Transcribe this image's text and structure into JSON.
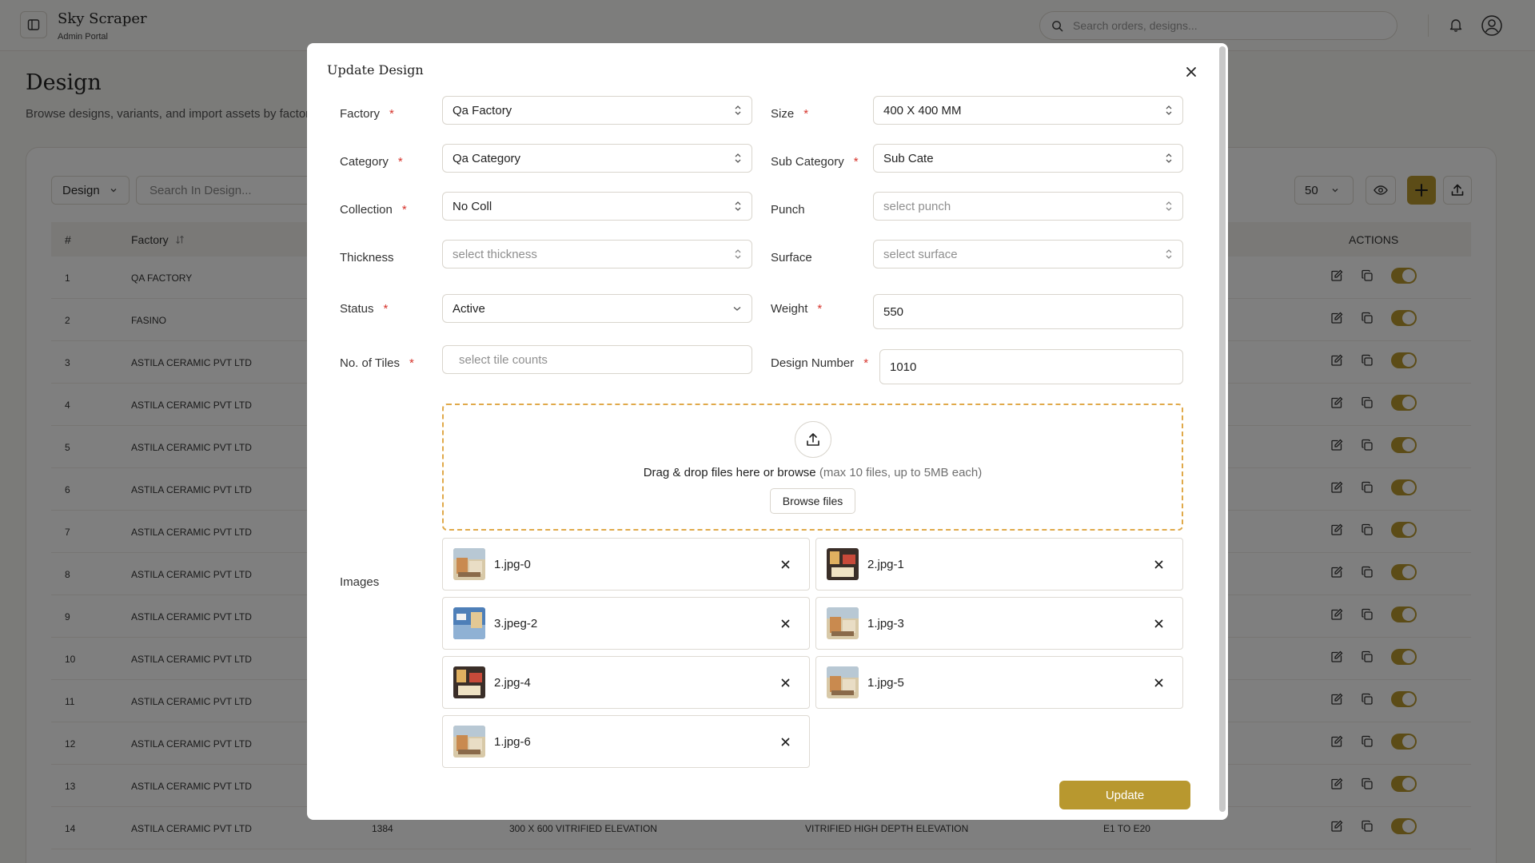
{
  "app": {
    "name": "Sky Scraper",
    "subtitle": "Admin Portal"
  },
  "topbar": {
    "search_placeholder": "Search orders, designs..."
  },
  "page": {
    "title": "Design",
    "subtitle": "Browse designs, variants, and import assets by factory"
  },
  "toolbar": {
    "design_select": "Design",
    "search_placeholder": "Search In Design...",
    "per_page": "50"
  },
  "table": {
    "columns": {
      "index": "#",
      "factory": "Factory",
      "actions": "ACTIONS"
    },
    "rows": [
      {
        "n": "1",
        "factory": "QA FACTORY",
        "c3": "",
        "c4": "",
        "c5": "",
        "c6": ""
      },
      {
        "n": "2",
        "factory": "FASINO",
        "c3": "",
        "c4": "",
        "c5": "",
        "c6": ""
      },
      {
        "n": "3",
        "factory": "ASTILA CERAMIC PVT LTD",
        "c3": "",
        "c4": "",
        "c5": "",
        "c6": ""
      },
      {
        "n": "4",
        "factory": "ASTILA CERAMIC PVT LTD",
        "c3": "",
        "c4": "",
        "c5": "",
        "c6": ""
      },
      {
        "n": "5",
        "factory": "ASTILA CERAMIC PVT LTD",
        "c3": "",
        "c4": "",
        "c5": "",
        "c6": ""
      },
      {
        "n": "6",
        "factory": "ASTILA CERAMIC PVT LTD",
        "c3": "",
        "c4": "",
        "c5": "",
        "c6": ""
      },
      {
        "n": "7",
        "factory": "ASTILA CERAMIC PVT LTD",
        "c3": "",
        "c4": "",
        "c5": "",
        "c6": ""
      },
      {
        "n": "8",
        "factory": "ASTILA CERAMIC PVT LTD",
        "c3": "",
        "c4": "",
        "c5": "",
        "c6": ""
      },
      {
        "n": "9",
        "factory": "ASTILA CERAMIC PVT LTD",
        "c3": "",
        "c4": "",
        "c5": "",
        "c6": ""
      },
      {
        "n": "10",
        "factory": "ASTILA CERAMIC PVT LTD",
        "c3": "",
        "c4": "",
        "c5": "",
        "c6": ""
      },
      {
        "n": "11",
        "factory": "ASTILA CERAMIC PVT LTD",
        "c3": "",
        "c4": "",
        "c5": "",
        "c6": ""
      },
      {
        "n": "12",
        "factory": "ASTILA CERAMIC PVT LTD",
        "c3": "",
        "c4": "",
        "c5": "",
        "c6": ""
      },
      {
        "n": "13",
        "factory": "ASTILA CERAMIC PVT LTD",
        "c3": "",
        "c4": "",
        "c5": "",
        "c6": ""
      },
      {
        "n": "14",
        "factory": "ASTILA CERAMIC PVT LTD",
        "c3": "1384",
        "c4": "300 X 600 VITRIFIED ELEVATION",
        "c5": "VITRIFIED HIGH DEPTH ELEVATION",
        "c6": "E1 TO E20"
      }
    ]
  },
  "modal": {
    "title": "Update Design",
    "required_mark": "*",
    "fields": {
      "factory": {
        "label": "Factory",
        "value": "Qa Factory"
      },
      "size": {
        "label": "Size",
        "value": "400 X 400 MM"
      },
      "category": {
        "label": "Category",
        "value": "Qa Category"
      },
      "sub_category": {
        "label": "Sub Category",
        "value": "Sub Cate"
      },
      "collection": {
        "label": "Collection",
        "value": "No Coll"
      },
      "punch": {
        "label": "Punch",
        "placeholder": "select punch"
      },
      "thickness": {
        "label": "Thickness",
        "placeholder": "select thickness"
      },
      "surface": {
        "label": "Surface",
        "placeholder": "select surface"
      },
      "status": {
        "label": "Status",
        "value": "Active"
      },
      "weight": {
        "label": "Weight",
        "value": "550"
      },
      "tiles": {
        "label": "No. of Tiles",
        "placeholder": "select tile counts"
      },
      "design_number": {
        "label": "Design Number",
        "value": "1010"
      },
      "images": {
        "label": "Images"
      }
    },
    "dropzone": {
      "text": "Drag & drop files here or browse",
      "hint": "(max 10 files, up to 5MB each)",
      "button": "Browse files"
    },
    "files": [
      "1.jpg-0",
      "2.jpg-1",
      "3.jpeg-2",
      "1.jpg-3",
      "2.jpg-4",
      "1.jpg-5",
      "1.jpg-6"
    ],
    "submit_label": "Update"
  },
  "colors": {
    "accent": "#b8982f",
    "required": "#d6332b",
    "dropzone_border": "#e0a94a",
    "overlay": "rgba(0,0,0,0.5)"
  }
}
